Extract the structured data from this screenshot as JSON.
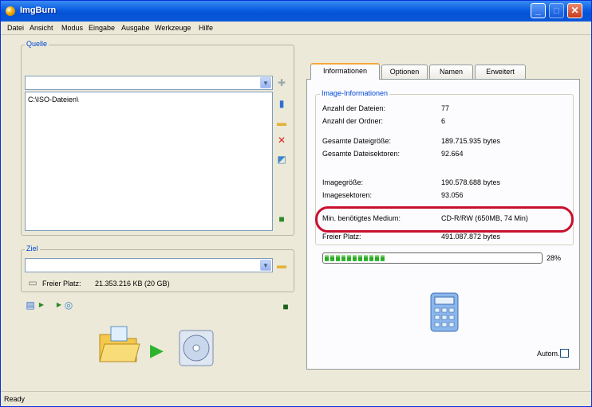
{
  "window": {
    "title": "ImgBurn"
  },
  "titlebar_buttons": {
    "minimize": "_",
    "maximize": "□",
    "close": "✕"
  },
  "menu": [
    "Datei",
    "Ansicht",
    "Modus",
    "Eingabe",
    "Ausgabe",
    "Werkzeuge",
    "Hilfe"
  ],
  "source": {
    "label": "Quelle",
    "combo_value": "",
    "list_items": [
      "C:\\ISO-Dateien\\"
    ]
  },
  "target": {
    "label": "Ziel",
    "combo_value": "",
    "free_space_label": "Freier Platz:",
    "free_space_value": "21.353.216 KB  (20 GB)"
  },
  "tabs": [
    "Informationen",
    "Optionen",
    "Namen",
    "Erweitert"
  ],
  "info": {
    "group_label": "Image-Informationen",
    "rows": [
      {
        "label": "Anzahl der Dateien:",
        "value": "77"
      },
      {
        "label": "Anzahl der Ordner:",
        "value": "6"
      },
      {
        "label": "Gesamte Dateigröße:",
        "value": "189.715.935 bytes"
      },
      {
        "label": "Gesamte Dateisektoren:",
        "value": "92.664"
      },
      {
        "label": "Imagegröße:",
        "value": "190.578.688 bytes"
      },
      {
        "label": "Imagesektoren:",
        "value": "93.056"
      },
      {
        "label": "Min. benötigtes Medium:",
        "value": "CD-R/RW (650MB, 74 Min)"
      },
      {
        "label": "Freier Platz:",
        "value": "491.087.872 bytes"
      }
    ],
    "progress_percent": 28,
    "progress_label": "28%"
  },
  "autorun_label": "Autom.",
  "autorun_checked": false,
  "status": {
    "text": "Ready"
  }
}
